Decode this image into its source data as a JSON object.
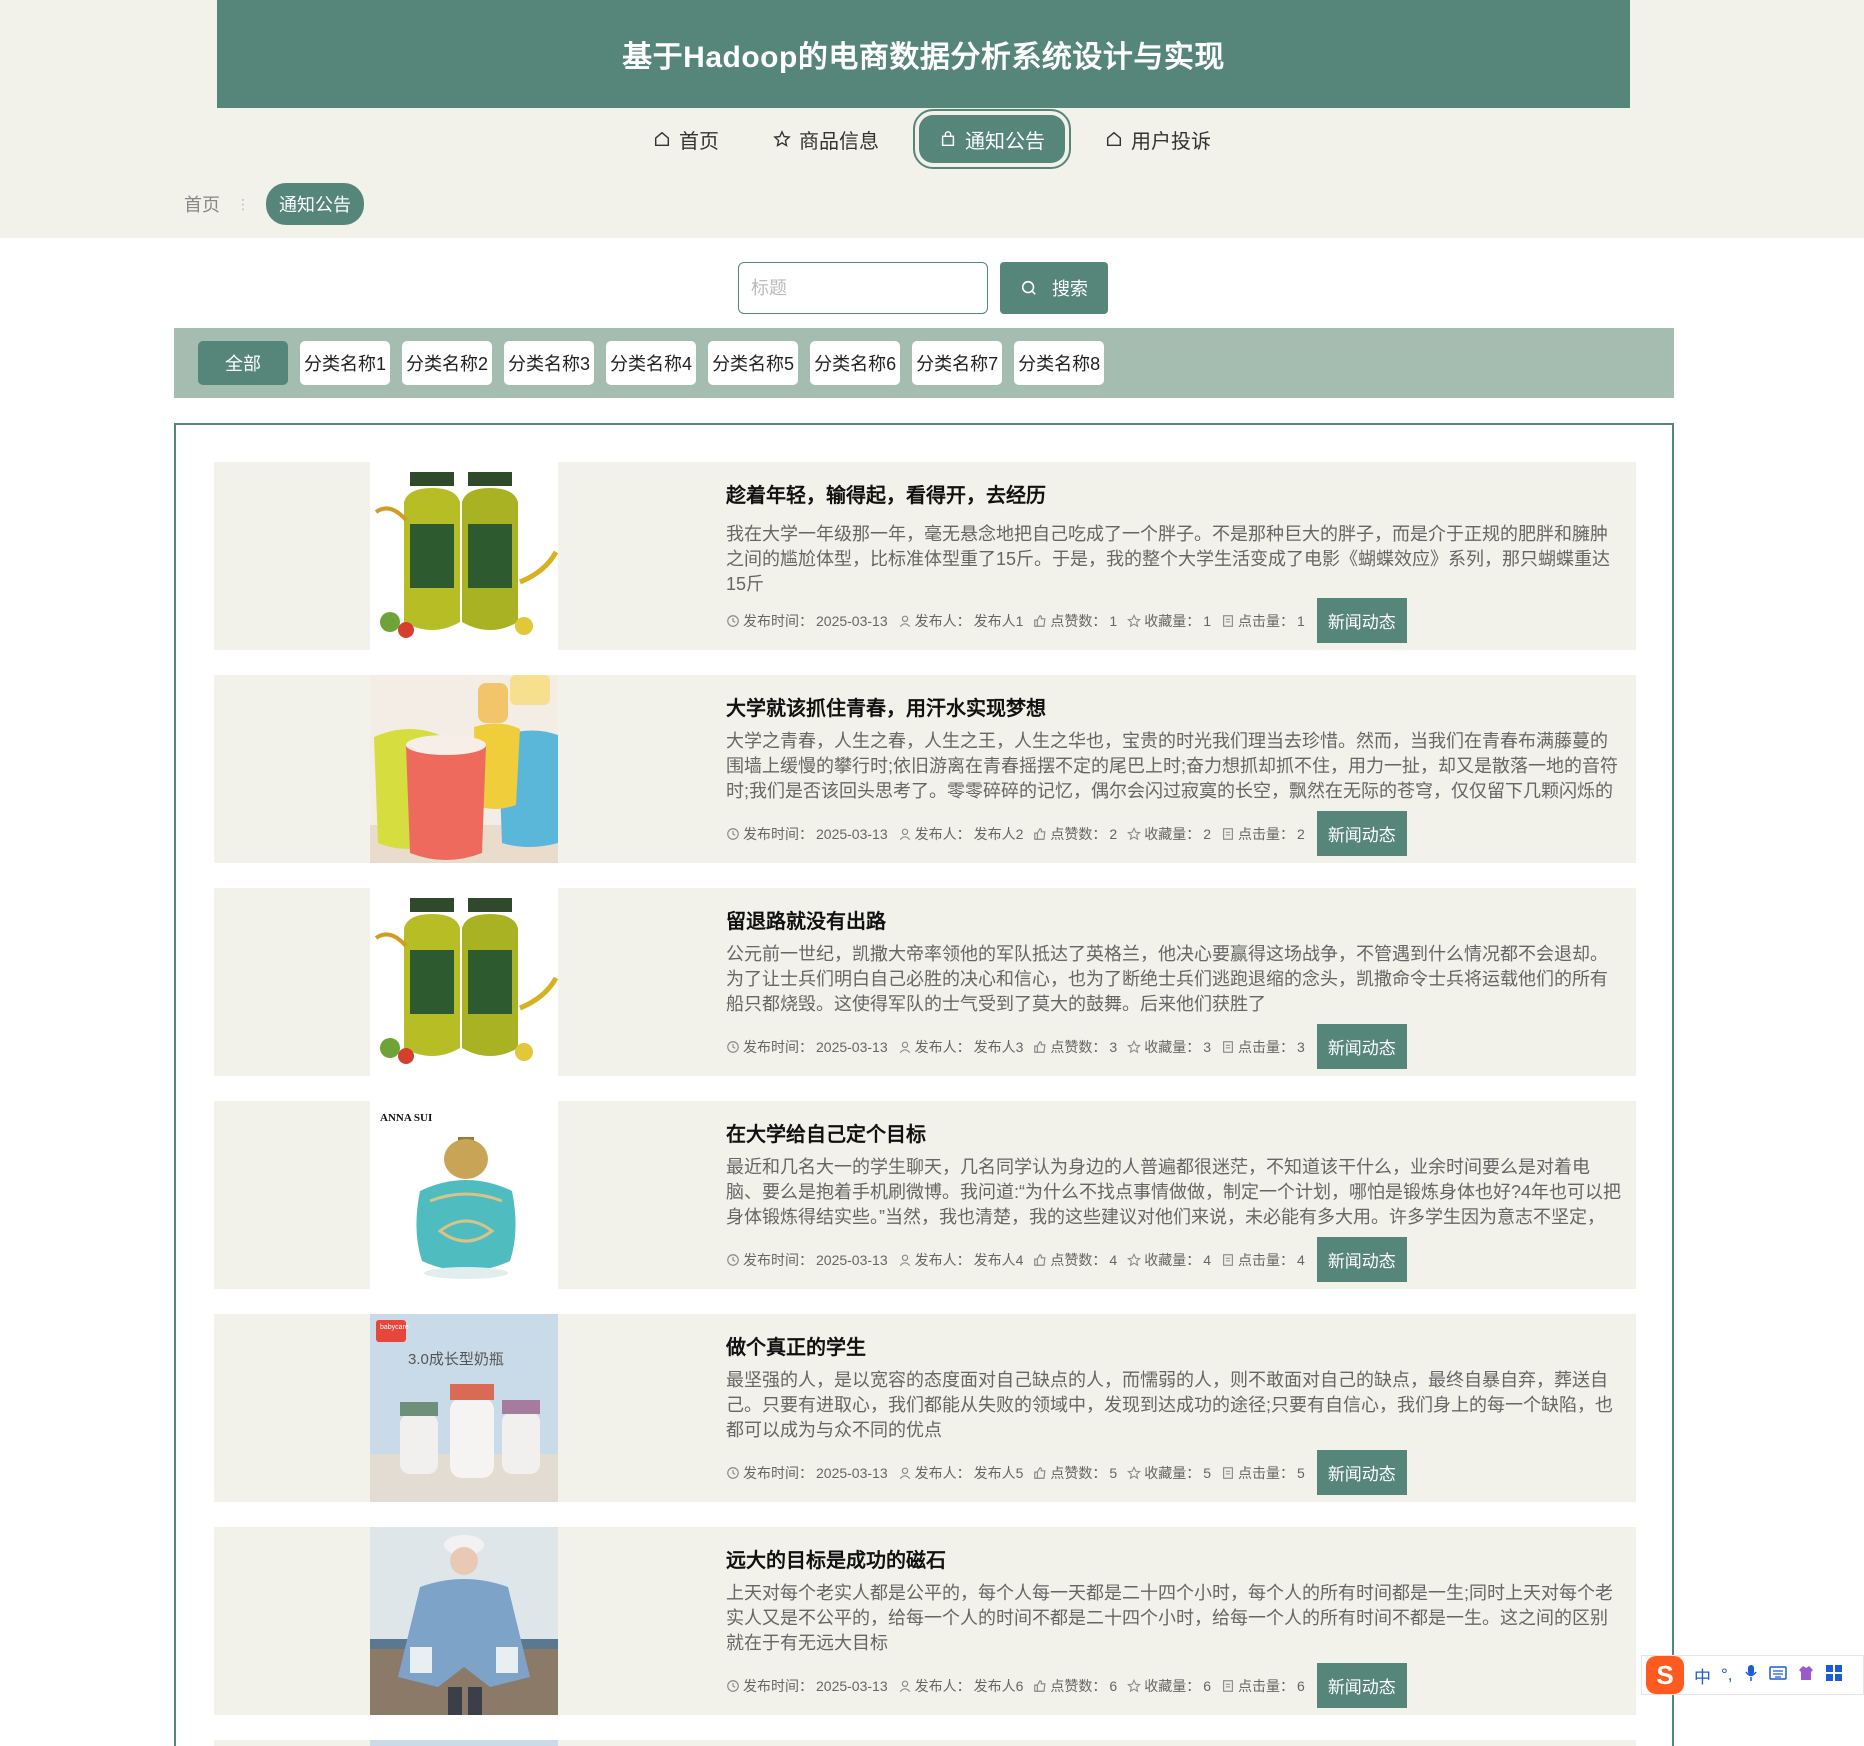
{
  "header": {
    "title": "基于Hadoop的电商数据分析系统设计与实现"
  },
  "nav": [
    {
      "label": "首页",
      "icon": "home-icon"
    },
    {
      "label": "商品信息",
      "icon": "star-icon"
    },
    {
      "label": "通知公告",
      "icon": "bag-icon",
      "active": true
    },
    {
      "label": "用户投诉",
      "icon": "home-icon"
    }
  ],
  "breadcrumb": {
    "home": "首页",
    "separator": "⋮",
    "current": "通知公告"
  },
  "search": {
    "placeholder": "标题",
    "button": "搜索"
  },
  "categories": [
    "全部",
    "分类名称1",
    "分类名称2",
    "分类名称3",
    "分类名称4",
    "分类名称5",
    "分类名称6",
    "分类名称7",
    "分类名称8"
  ],
  "meta_labels": {
    "time": "发布时间：",
    "author": "发布人：",
    "likes": "点赞数：",
    "favs": "收藏量：",
    "clicks": "点击量："
  },
  "items": [
    {
      "title": "趁着年轻，输得起，看得开，去经历",
      "excerpt": "我在大学一年级那一年，毫无悬念地把自己吃成了一个胖子。不是那种巨大的胖子，而是介于正规的肥胖和臃肿之间的尴尬体型，比标准体型重了15斤。于是，我的整个大学生活变成了电影《蝴蝶效应》系列，那只蝴蝶重达15斤",
      "time": "2025-03-13",
      "author": "发布人1",
      "likes": "1",
      "favs": "1",
      "clicks": "1",
      "tag": "新闻动态",
      "image": "oil-bottles"
    },
    {
      "title": "大学就该抓住青春，用汗水实现梦想",
      "excerpt": "大学之青春，人生之春，人生之王，人生之华也，宝贵的时光我们理当去珍惜。然而，当我们在青春布满藤蔓的围墙上缓慢的攀行时;依旧游离在青春摇摆不定的尾巴上时;奋力想抓却抓不住，用力一扯，却又是散落一地的音符时;我们是否该回头思考了。零零碎碎的记忆，偶尔会闪过寂寞的长空，飘然在无际的苍穹，仅仅留下几颗闪烁的残星让我们",
      "time": "2025-03-13",
      "author": "发布人2",
      "likes": "2",
      "favs": "2",
      "clicks": "2",
      "tag": "新闻动态",
      "image": "cups"
    },
    {
      "title": "留退路就没有出路",
      "excerpt": "公元前一世纪，凯撒大帝率领他的军队抵达了英格兰，他决心要赢得这场战争，不管遇到什么情况都不会退却。为了让士兵们明白自己必胜的决心和信心，也为了断绝士兵们逃跑退缩的念头，凯撒命令士兵将运载他们的所有船只都烧毁。这使得军队的士气受到了莫大的鼓舞。后来他们获胜了",
      "time": "2025-03-13",
      "author": "发布人3",
      "likes": "3",
      "favs": "3",
      "clicks": "3",
      "tag": "新闻动态",
      "image": "oil-bottles"
    },
    {
      "title": "在大学给自己定个目标",
      "excerpt": "最近和几名大一的学生聊天，几名同学认为身边的人普遍都很迷茫，不知道该干什么，业余时间要么是对着电脑、要么是抱着手机刷微博。我问道:“为什么不找点事情做做，制定一个计划，哪怕是锻炼身体也好?4年也可以把身体锻炼得结实些。”当然，我也清楚，我的这些建议对他们来说，未必能有多大用。许多学生因为意志不坚定，没有老师",
      "time": "2025-03-13",
      "author": "发布人4",
      "likes": "4",
      "favs": "4",
      "clicks": "4",
      "tag": "新闻动态",
      "image": "perfume",
      "image_text": "ANNA SUI"
    },
    {
      "title": "做个真正的学生",
      "excerpt": "最坚强的人，是以宽容的态度面对自己缺点的人，而懦弱的人，则不敢面对自己的缺点，最终自暴自弃，葬送自己。只要有进取心，我们都能从失败的领域中，发现到达成功的途径;只要有自信心，我们身上的每一个缺陷，也都可以成为与众不同的优点",
      "time": "2025-03-13",
      "author": "发布人5",
      "likes": "5",
      "favs": "5",
      "clicks": "5",
      "tag": "新闻动态",
      "image": "baby-bottles",
      "image_text": "3.0成长型奶瓶",
      "image_badge": "babycare"
    },
    {
      "title": "远大的目标是成功的磁石",
      "excerpt": "上天对每个老实人都是公平的，每个人每一天都是二十四个小时，每个人的所有时间都是一生;同时上天对每个老实人又是不公平的，给每一个人的时间不都是二十四个小时，给每一个人的所有时间不都是一生。这之间的区别就在于有无远大目标",
      "time": "2025-03-13",
      "author": "发布人6",
      "likes": "6",
      "favs": "6",
      "clicks": "6",
      "tag": "新闻动态",
      "image": "denim-jacket"
    }
  ],
  "ime": {
    "label": "中",
    "punct": "°,",
    "logo": "S"
  }
}
